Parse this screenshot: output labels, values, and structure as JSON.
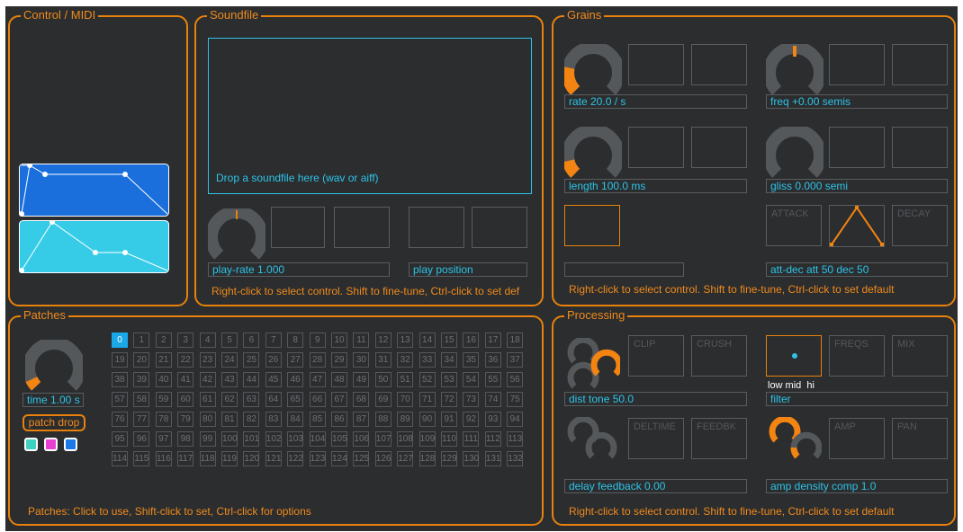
{
  "panels": {
    "control": {
      "title": "Control / MIDI"
    },
    "soundfile": {
      "title": "Soundfile",
      "drop_text": "Drop a soundfile here (wav or aiff)",
      "play_rate": "play-rate 1.000",
      "play_position": "play position",
      "hint": "Right-click to select control. Shift to fine-tune, Ctrl-click to set def"
    },
    "grains": {
      "title": "Grains",
      "rate": "rate 20.0 / s",
      "freq": "freq +0.00 semis",
      "length": "length 100.0 ms",
      "gliss": "gliss 0.000 semi",
      "attack": "ATTACK",
      "decay": "DECAY",
      "attdec": "att-dec att 50 dec 50",
      "hint": "Right-click to select control. Shift to fine-tune, Ctrl-click to set default"
    },
    "patches": {
      "title": "Patches",
      "time": "time 1.00 s",
      "patch_drop": "patch drop",
      "hint": "Patches: Click to use, Shift-click to set, Ctrl-click for options",
      "swatch_colors": [
        "#3fd1c0",
        "#e83fd3",
        "#1a7ae6"
      ]
    },
    "processing": {
      "title": "Processing",
      "clip": "CLIP",
      "crush": "CRUSH",
      "freqs": "FREQS",
      "mix": "MIX",
      "dist_tone": "dist tone 50.0",
      "filter_bands": "low mid  hi",
      "filter": "filter",
      "deltime": "DELTIME",
      "feedbk": "FEEDBK",
      "amp": "AMP",
      "pan": "PAN",
      "delay_feedback": "delay feedback 0.00",
      "amp_density": "amp density comp 1.0",
      "hint": "Right-click to select control. Shift to fine-tune, Ctrl-click to set default"
    }
  },
  "patch_count": 133,
  "selected_patch": 0,
  "colors": {
    "accent": "#e8820c",
    "cyan": "#2ec3e6",
    "knob_track": "#55585b",
    "bg": "#2b2d2f"
  },
  "icons": [
    "rotary-knob-icon",
    "envelope-graph-icon",
    "triangle-envelope-icon"
  ]
}
